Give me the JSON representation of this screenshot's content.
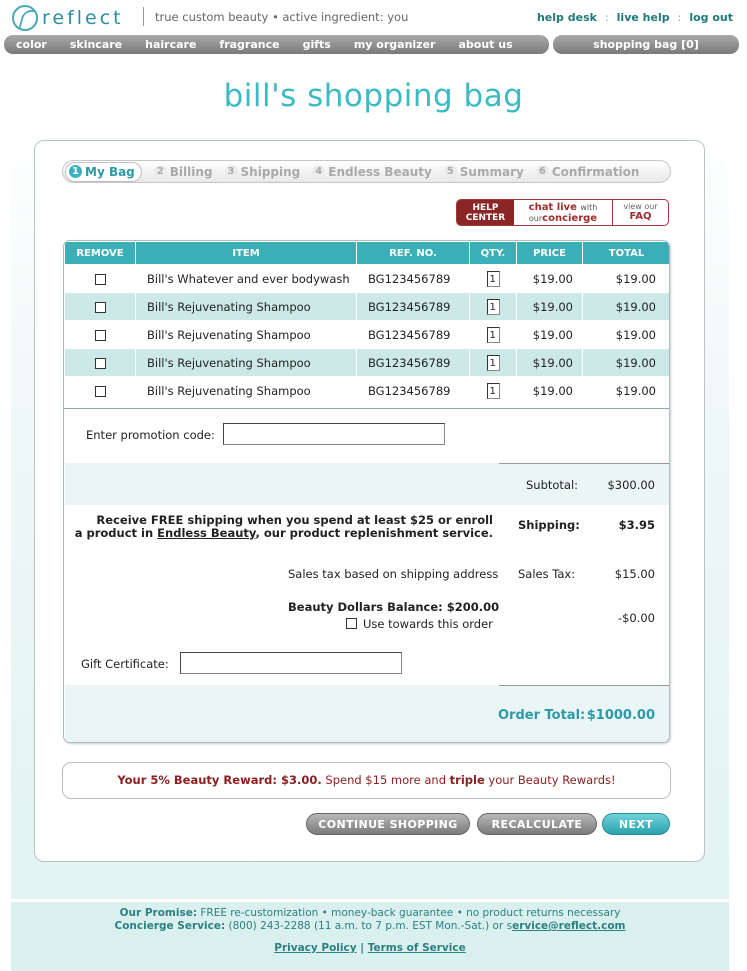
{
  "header": {
    "logo_text": "reflect",
    "tagline": "true custom beauty • active ingredient: you",
    "links": [
      "help desk",
      "live help",
      "log out"
    ]
  },
  "nav": {
    "items": [
      "color",
      "skincare",
      "haircare",
      "fragrance",
      "gifts",
      "my organizer",
      "about us"
    ],
    "bag_label": "shopping bag [0]"
  },
  "page_title": "bill's shopping bag",
  "steps": [
    {
      "num": "1",
      "label": "My Bag",
      "active": true
    },
    {
      "num": "2",
      "label": "Billing",
      "active": false
    },
    {
      "num": "3",
      "label": "Shipping",
      "active": false
    },
    {
      "num": "4",
      "label": "Endless Beauty",
      "active": false
    },
    {
      "num": "5",
      "label": "Summary",
      "active": false
    },
    {
      "num": "6",
      "label": "Confirmation",
      "active": false
    }
  ],
  "help": {
    "center_line1": "HELP",
    "center_line2": "CENTER",
    "chat_a": "chat live",
    "chat_b": "with",
    "chat_c": "our",
    "chat_d": "concierge",
    "faq_a": "view our",
    "faq_b": "FAQ"
  },
  "table": {
    "headers": [
      "REMOVE",
      "ITEM",
      "REF. NO.",
      "QTY.",
      "PRICE",
      "TOTAL"
    ],
    "rows": [
      {
        "item": "Bill's Whatever and ever bodywash",
        "ref": "BG123456789",
        "qty": "1",
        "price": "$19.00",
        "total": "$19.00"
      },
      {
        "item": "Bill's Rejuvenating Shampoo",
        "ref": "BG123456789",
        "qty": "1",
        "price": "$19.00",
        "total": "$19.00"
      },
      {
        "item": "Bill's Rejuvenating Shampoo",
        "ref": "BG123456789",
        "qty": "1",
        "price": "$19.00",
        "total": "$19.00"
      },
      {
        "item": "Bill's Rejuvenating Shampoo",
        "ref": "BG123456789",
        "qty": "1",
        "price": "$19.00",
        "total": "$19.00"
      },
      {
        "item": "Bill's Rejuvenating Shampoo",
        "ref": "BG123456789",
        "qty": "1",
        "price": "$19.00",
        "total": "$19.00"
      }
    ]
  },
  "promo": {
    "label": "Enter promotion code:",
    "value": ""
  },
  "summary": {
    "subtotal_label": "Subtotal:",
    "subtotal_value": "$300.00",
    "free_ship_line1": "Receive FREE shipping when you spend at least $25 or enroll",
    "free_ship_line2_pre": "a product in ",
    "free_ship_link": "Endless Beauty",
    "free_ship_line2_post": ", our product replenishment service.",
    "shipping_label": "Shipping:",
    "shipping_value": "$3.95",
    "tax_note": "Sales tax based on shipping address",
    "tax_label": "Sales Tax:",
    "tax_value": "$15.00",
    "beauty_balance": "Beauty Dollars Balance: $200.00",
    "use_towards": "Use towards this order",
    "beauty_value": "-$0.00",
    "gift_label": "Gift Certificate:",
    "gift_value": "",
    "order_total_label": "Order Total:",
    "order_total_value": "$1000.00"
  },
  "reward": {
    "strong": "Your 5% Beauty Reward: $3.00.",
    "mid": " Spend $15 more and ",
    "triple": "triple",
    "end": " your Beauty Rewards!"
  },
  "buttons": {
    "continue": "CONTINUE SHOPPING",
    "recalculate": "RECALCULATE",
    "next": "NEXT"
  },
  "footer": {
    "promise_label": "Our Promise:",
    "promise_text": " FREE re-customization • money-back guarantee • no product returns necessary",
    "concierge_label": "Concierge Service:",
    "concierge_text": " (800) 243-2288 (11 a.m. to 7 p.m. EST Mon.-Sat.) or s",
    "email": "ervice@reflect.com",
    "privacy": "Privacy Policy",
    "sep": " | ",
    "terms": "Terms of Service"
  },
  "colors": {
    "accent": "#3bafb7",
    "title": "#3bbcc4",
    "brand_red": "#8b2626"
  }
}
